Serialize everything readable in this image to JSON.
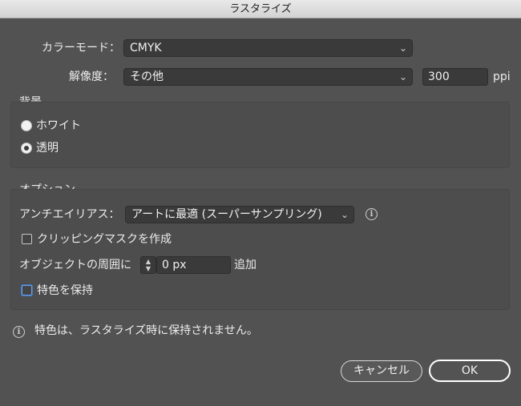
{
  "window": {
    "title": "ラスタライズ"
  },
  "color_mode": {
    "label": "カラーモード：",
    "value": "CMYK"
  },
  "resolution": {
    "label": "解像度：",
    "value": "その他",
    "ppi_value": "300",
    "unit": "ppi"
  },
  "background": {
    "heading": "背景",
    "options": [
      {
        "label": "ホワイト",
        "selected": false
      },
      {
        "label": "透明",
        "selected": true
      }
    ]
  },
  "options": {
    "heading": "オプション",
    "antialias": {
      "label": "アンチエイリアス：",
      "value": "アートに最適 (スーパーサンプリング)"
    },
    "clipping_mask": {
      "label": "クリッピングマスクを作成",
      "checked": false
    },
    "around_object": {
      "label": "オブジェクトの周囲に",
      "value": "0 px",
      "suffix": "追加"
    },
    "keep_spot": {
      "label": "特色を保持",
      "checked": false
    }
  },
  "notice": {
    "text": "特色は、ラスタライズ時に保持されません。"
  },
  "buttons": {
    "cancel": "キャンセル",
    "ok": "OK"
  },
  "icons": {
    "chevron": "chevron-down-icon",
    "info": "info-icon",
    "stepper": "stepper-icon"
  },
  "colors": {
    "background": "#525252",
    "field": "#3a3a3a",
    "focus": "#3d79c2"
  }
}
